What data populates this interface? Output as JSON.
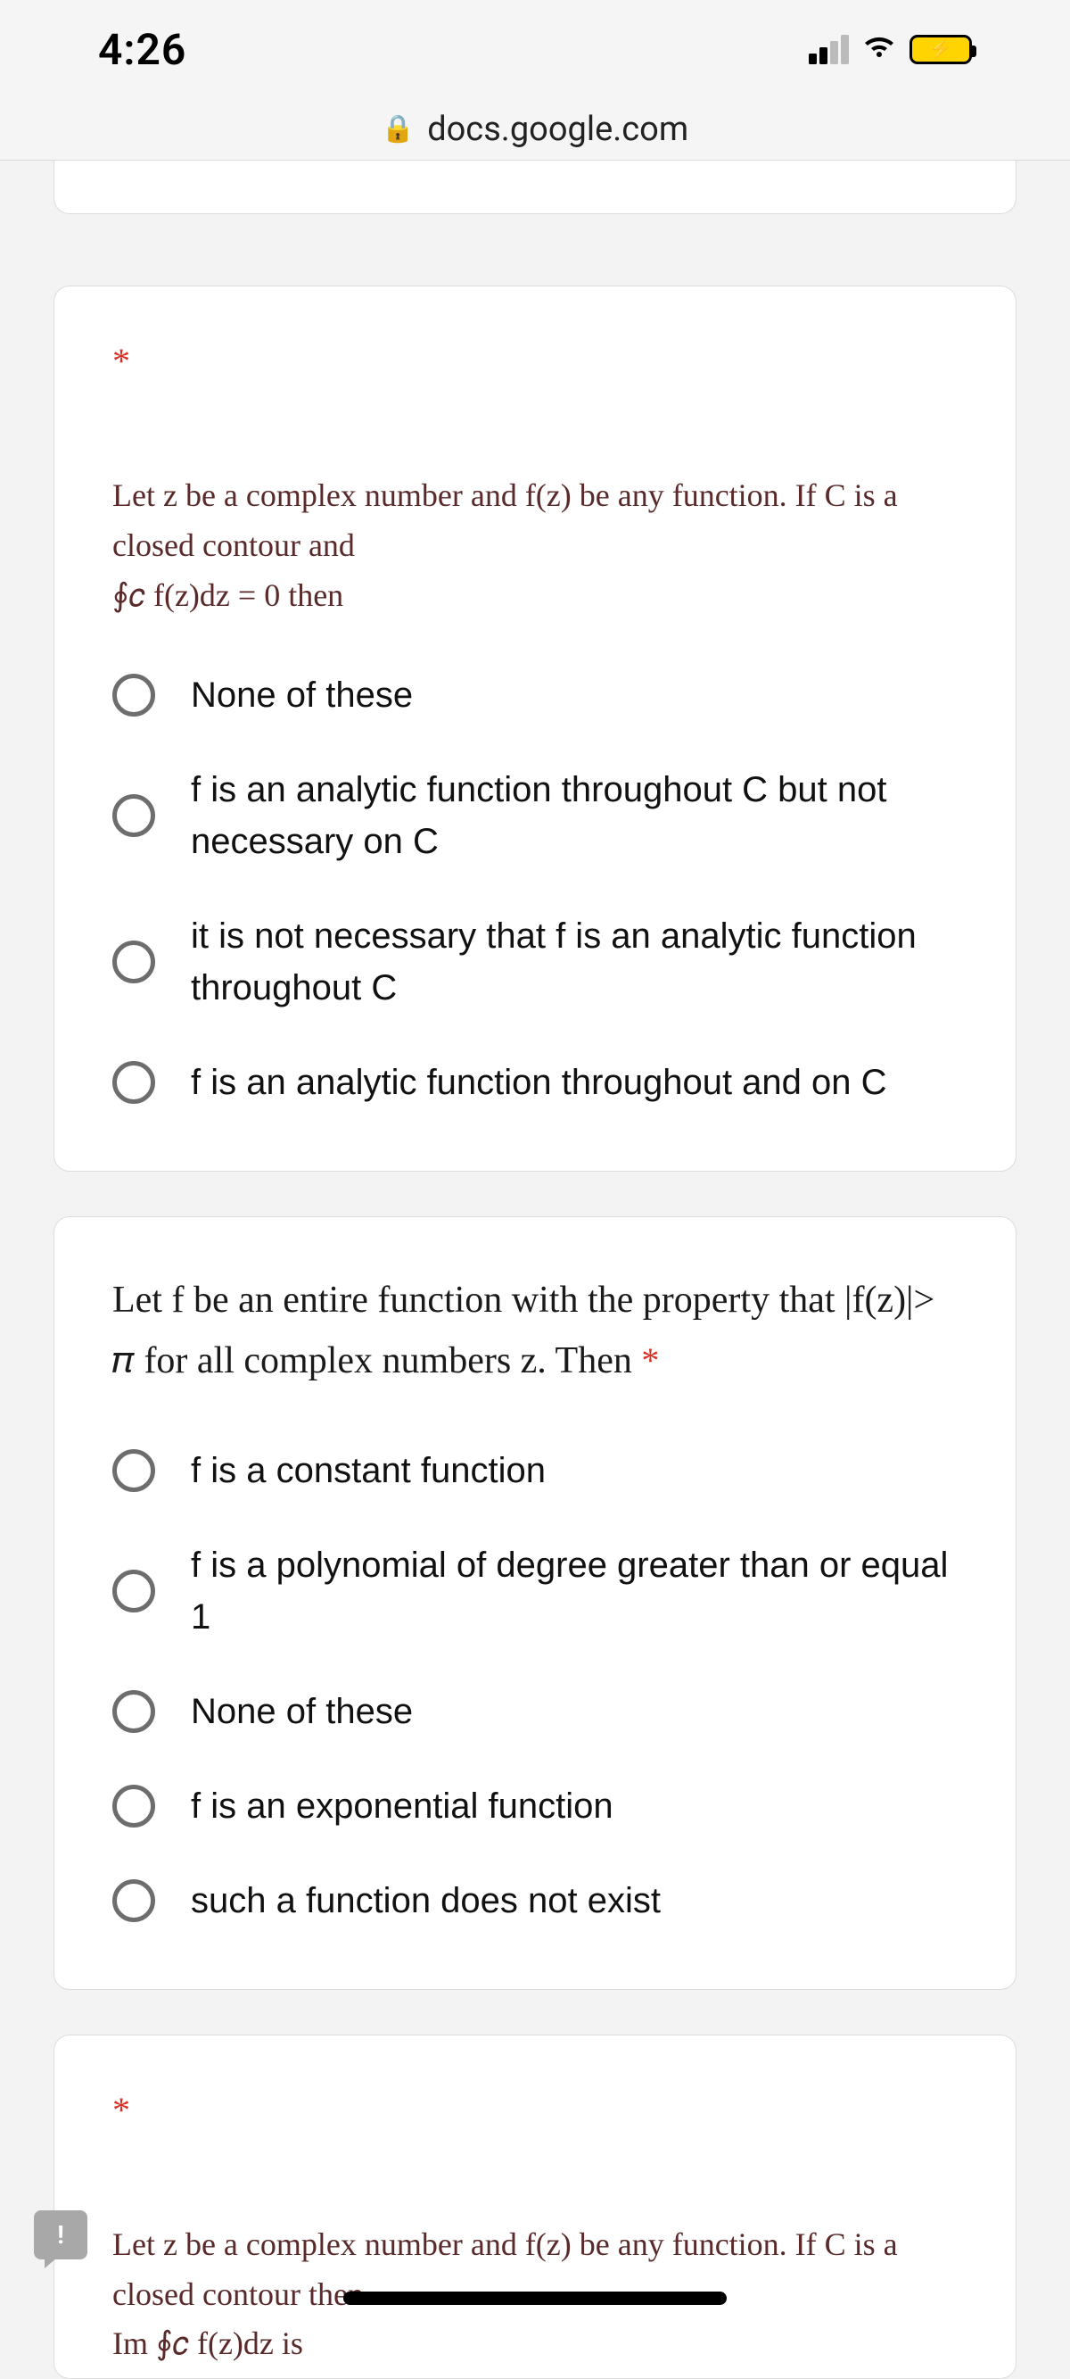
{
  "status": {
    "time": "4:26"
  },
  "url": "docs.google.com",
  "questions": {
    "q1": {
      "required_mark": "*",
      "prompt_line1": "Let z be a complex number and f(z) be any function. If C is a closed contour and",
      "prompt_line2": "∮𝑐 f(z)dz = 0 then",
      "options": {
        "a": "None of these",
        "b": "f is an analytic function throughout C but not necessary on C",
        "c": "it is not necessary that f is an analytic function throughout C",
        "d": "f is an analytic function throughout and on C"
      }
    },
    "q2": {
      "prompt": "Let f be an entire function with the property that |f(z)|> 𝜋 for all complex numbers z. Then",
      "required_mark": "*",
      "options": {
        "a": "f is a constant function",
        "b": "f is a polynomial of degree greater than or equal 1",
        "c": "None of these",
        "d": "f is an exponential function",
        "e": "such a function does not exist"
      }
    },
    "q3": {
      "required_mark": "*",
      "prompt_line1": "Let z be a complex number and f(z) be any function. If C is a closed contour then",
      "prompt_line2": "Im ∮𝑐 f(z)dz is"
    }
  },
  "report_glyph": "!"
}
